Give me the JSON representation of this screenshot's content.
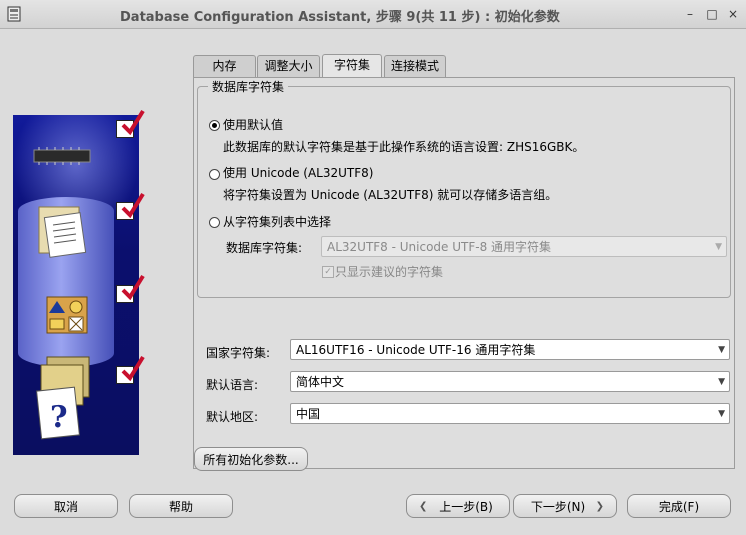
{
  "window": {
    "title": "Database Configuration Assistant, 步骤 9(共 11 步) : 初始化参数",
    "controls": [
      "–",
      "□",
      "×"
    ]
  },
  "tabs": [
    {
      "label": "内存",
      "active": false
    },
    {
      "label": "调整大小",
      "active": false
    },
    {
      "label": "字符集",
      "active": true
    },
    {
      "label": "连接模式",
      "active": false
    }
  ],
  "charset_group": {
    "legend": "数据库字符集",
    "options": [
      {
        "label": "使用默认值",
        "selected": true,
        "desc": "此数据库的默认字符集是基于此操作系统的语言设置: ZHS16GBK。"
      },
      {
        "label": "使用 Unicode (AL32UTF8)",
        "selected": false,
        "desc": "将字符集设置为 Unicode (AL32UTF8) 就可以存储多语言组。"
      },
      {
        "label": "从字符集列表中选择",
        "selected": false
      }
    ],
    "db_charset_label": "数据库字符集:",
    "db_charset_value": "AL32UTF8 - Unicode UTF-8 通用字符集",
    "recommended_only_label": "只显示建议的字符集",
    "recommended_only_checked": true
  },
  "fields": {
    "national_charset_label": "国家字符集:",
    "national_charset_value": "AL16UTF16 - Unicode UTF-16 通用字符集",
    "default_language_label": "默认语言:",
    "default_language_value": "简体中文",
    "default_territory_label": "默认地区:",
    "default_territory_value": "中国"
  },
  "all_params_button": "所有初始化参数...",
  "footer": {
    "cancel": "取消",
    "help": "帮助",
    "back": "上一步(B)",
    "next": "下一步(N)",
    "finish": "完成(F)"
  }
}
